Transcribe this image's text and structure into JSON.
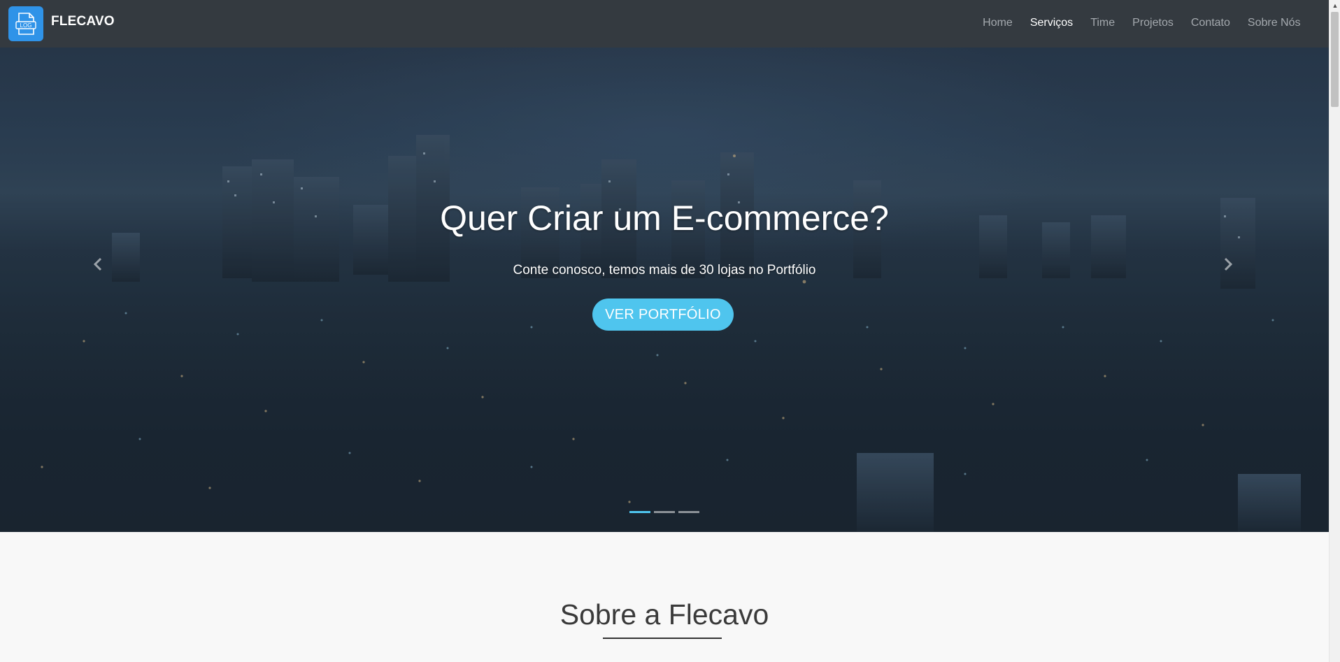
{
  "navbar": {
    "logo_text": "LOG",
    "brand": "FLECAVO",
    "links": [
      {
        "label": "Home",
        "active": false
      },
      {
        "label": "Serviços",
        "active": true
      },
      {
        "label": "Time",
        "active": false
      },
      {
        "label": "Projetos",
        "active": false
      },
      {
        "label": "Contato",
        "active": false
      },
      {
        "label": "Sobre Nós",
        "active": false
      }
    ]
  },
  "hero": {
    "title": "Quer Criar um E-commerce?",
    "subtitle": "Conte conosco, temos mais de 30 lojas no Portfólio",
    "button_label": "VER PORTFÓLIO",
    "prev_icon": "chevron-left-icon",
    "next_icon": "chevron-right-icon",
    "slides_count": 3,
    "active_slide": 0
  },
  "about": {
    "title": "Sobre a Flecavo"
  },
  "colors": {
    "navbar_bg": "#343a40",
    "accent": "#4fc5ee",
    "logo_bg": "#2f93e8"
  }
}
